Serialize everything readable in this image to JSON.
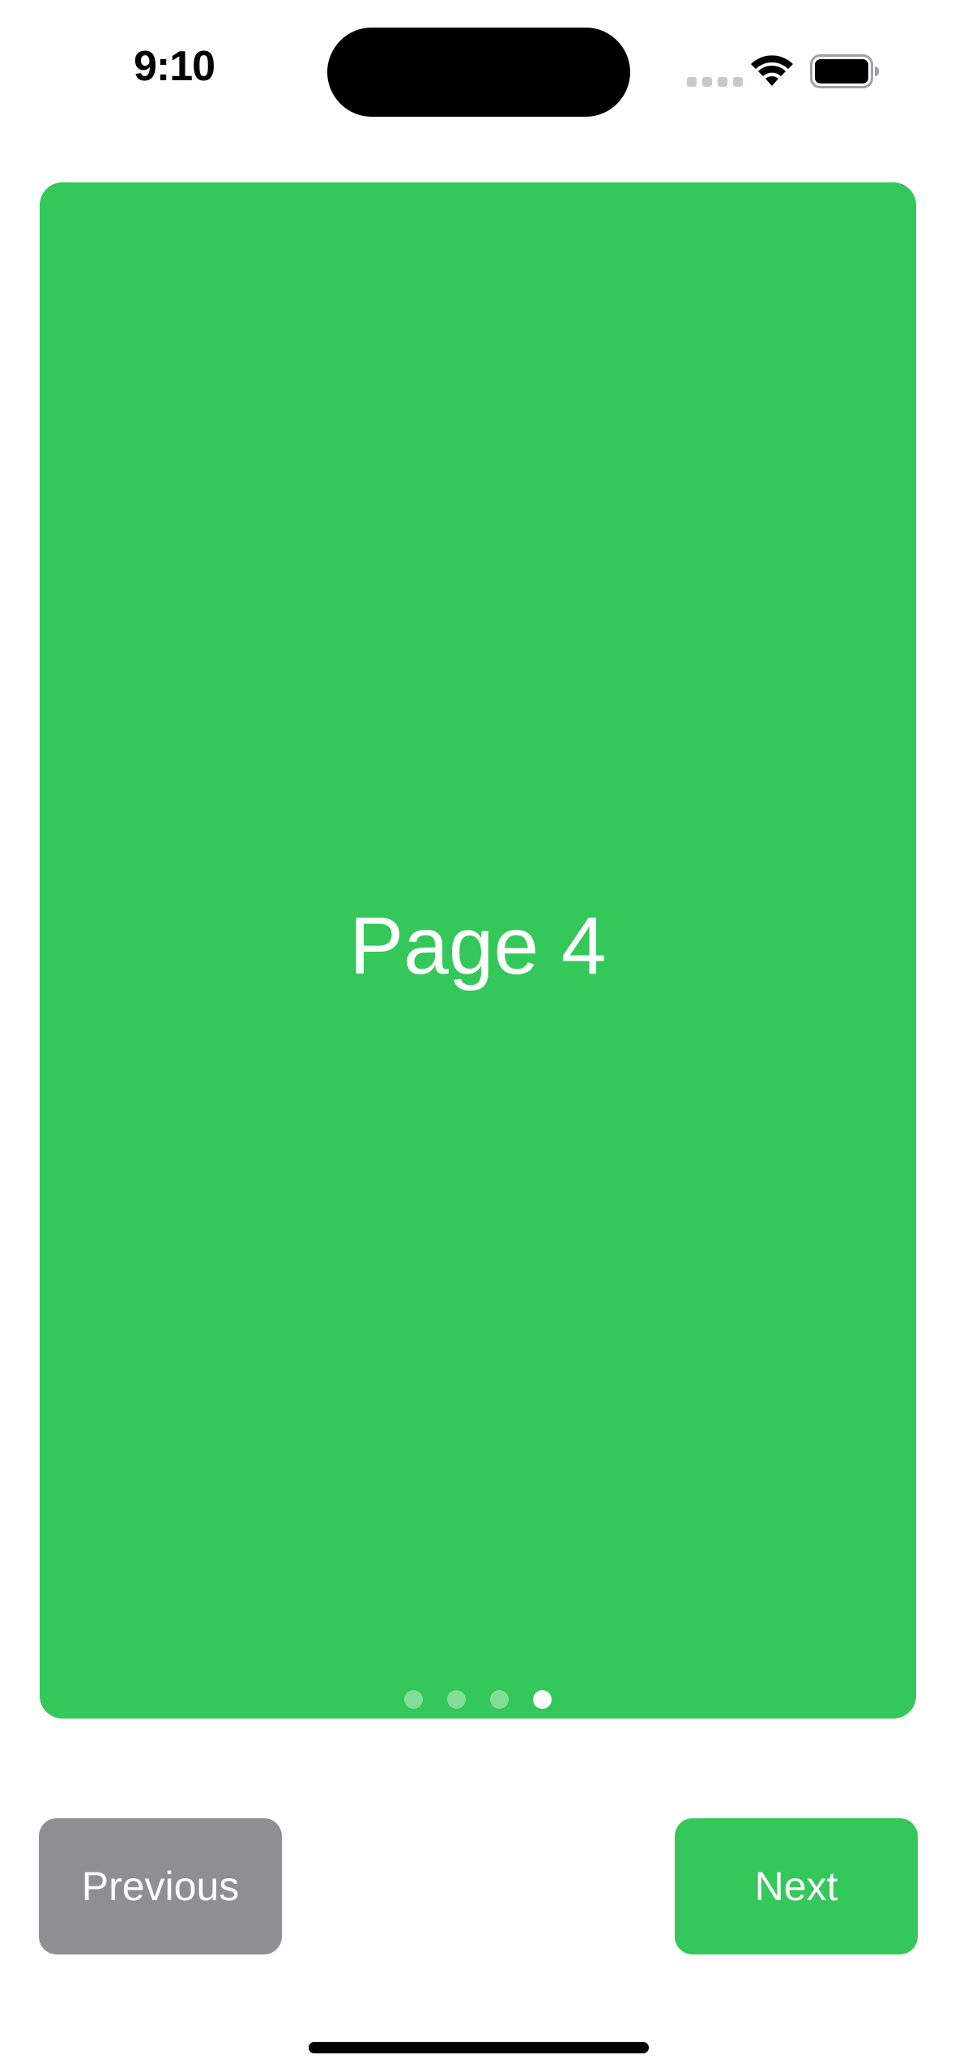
{
  "status_bar": {
    "time": "9:10",
    "signal_icon": "cellular-signal-icon",
    "wifi_icon": "wifi-icon",
    "battery_icon": "battery-icon"
  },
  "pager": {
    "current_page_label": "Page 4",
    "page_count": 4,
    "current_page_index": 3,
    "page_color": "#34C759"
  },
  "buttons": {
    "previous_label": "Previous",
    "previous_color": "#8E8E93",
    "next_label": "Next",
    "next_color": "#34C759"
  }
}
